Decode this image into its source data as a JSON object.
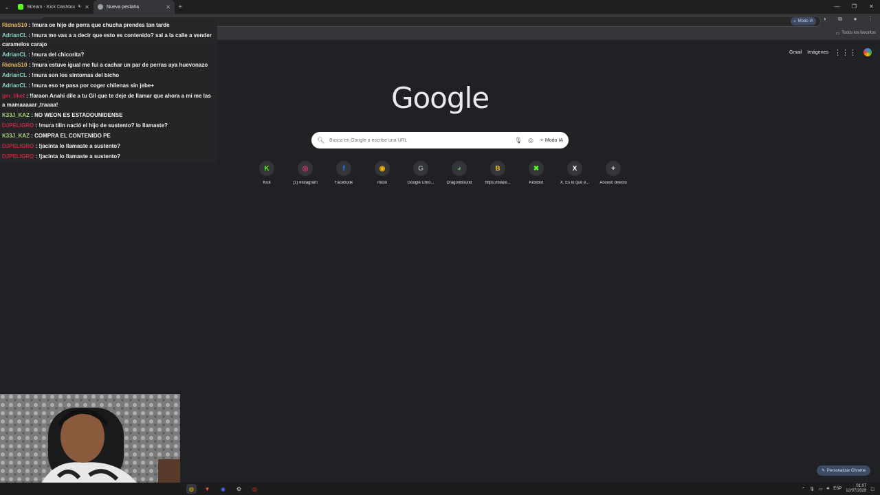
{
  "browser": {
    "tabs": [
      {
        "title": "Stream - Kick Dashboard",
        "favicon": "kick-icon",
        "color": "#53fc18"
      },
      {
        "title": "Nueva pestaña",
        "favicon": "chrome-icon",
        "color": "#9aa0a6"
      }
    ],
    "modo_ia_label": "Modo IA",
    "bookmarks_all": "Todos los favoritos"
  },
  "page": {
    "logo": "Google",
    "top_links": {
      "gmail": "Gmail",
      "images": "Imágenes"
    },
    "search": {
      "placeholder": "Busca en Google o escribe una URL",
      "mode_label": "Modo IA"
    },
    "shortcuts": [
      {
        "label": "Kick",
        "glyph": "K",
        "color": "#53fc18"
      },
      {
        "label": "(1) Instagram",
        "glyph": "◎",
        "color": "#e1306c"
      },
      {
        "label": "Facebook",
        "glyph": "f",
        "color": "#1877f2"
      },
      {
        "label": "Inicio",
        "glyph": "◉",
        "color": "#f5b400"
      },
      {
        "label": "Google Chro...",
        "glyph": "G",
        "color": "#9aa0a6"
      },
      {
        "label": "DragonBound",
        "glyph": "◕",
        "color": "#4caf50"
      },
      {
        "label": "https://blaze...",
        "glyph": "B",
        "color": "#f5c518"
      },
      {
        "label": "KickBot",
        "glyph": "✖",
        "color": "#53fc18"
      },
      {
        "label": "X. Es lo que e...",
        "glyph": "X",
        "color": "#ffffff"
      },
      {
        "label": "Acceso directo",
        "glyph": "+",
        "color": "#e8eaed"
      }
    ],
    "customize_label": "Personalizar Chrome"
  },
  "chat": [
    {
      "user": "RidnaS10",
      "user_class": "gold",
      "text": "!mura oe hijo de perra que chucha prendes tan tarde"
    },
    {
      "user": "AdrianCL",
      "user_class": "teal",
      "text": "!mura me vas a a decir que esto es contenido? sal a la calle a vender caramelos carajo"
    },
    {
      "user": "AdrianCL",
      "user_class": "teal",
      "text": "!mura del chicorita?"
    },
    {
      "user": "RidnaS10",
      "user_class": "gold",
      "text": "!mura estuve igual me fui a cachar un par de perras aya huevonazo"
    },
    {
      "user": "AdrianCL",
      "user_class": "teal",
      "text": "!mura son los sintomas del bicho"
    },
    {
      "user": "AdrianCL",
      "user_class": "teal",
      "text": "!mura eso te pasa por coger chilenas sin jebe+"
    },
    {
      "user": "gm_tiket",
      "user_class": "red",
      "text": "!faraon Anahi dile a tu Gil que te deje de llamar que ahora a mi me las a mamaaaaar ,traaaa!"
    },
    {
      "user": "K33J_KAZ",
      "user_class": "",
      "text": "NO WEON ES ESTADOUNIDENSE"
    },
    {
      "user": "DJPELIGRO",
      "user_class": "red",
      "text": "!mura tilin nació el hijo de sustento? lo llamaste?"
    },
    {
      "user": "K33J_KAZ",
      "user_class": "",
      "text": "COMPRA EL CONTENIDO PE"
    },
    {
      "user": "DJPELIGRO",
      "user_class": "red",
      "text": "!jacinta lo llamaste a sustento?"
    },
    {
      "user": "DJPELIGRO",
      "user_class": "red",
      "text": "!jacinta lo llamaste a sustento?"
    }
  ],
  "taskbar": {
    "lang": "ESP",
    "time": "01:07",
    "date": "12/07/2026"
  }
}
